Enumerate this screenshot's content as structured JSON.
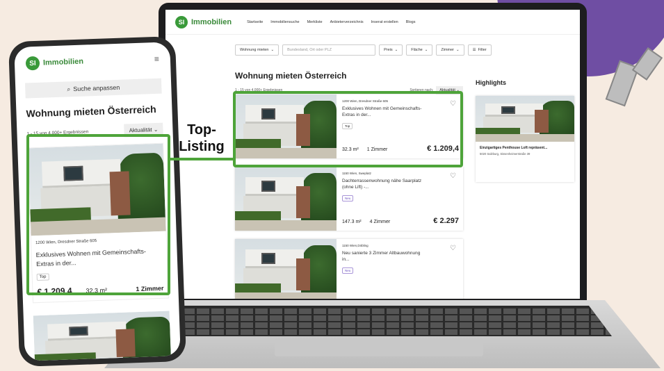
{
  "brand": {
    "name": "Immobilien",
    "mark": "SI",
    "accent": "#3a9a3a",
    "highlight_color": "#4ea43a",
    "deco_color": "#6f4ea3"
  },
  "desktop": {
    "nav": [
      "Startseite",
      "Immobiliensuche",
      "Merkliste",
      "Anbieterverzeichnis",
      "Inserat erstellen",
      "Blogs"
    ],
    "search": {
      "type_label": "Wohnung mieten",
      "placeholder": "Bundesland, Ort oder PLZ",
      "filters": [
        "Preis",
        "Fläche",
        "Zimmer"
      ],
      "more_filters": "Filter"
    },
    "title": "Wohnung mieten Österreich",
    "count": "1 - 15 von 4.000+ Ergebnissen",
    "sort_label": "Sortieren nach:",
    "sort_value": "Aktualität",
    "highlights_title": "Highlights",
    "listings": [
      {
        "address": "1200 Wien, Dresdner Straße 605",
        "title": "Exklusives Wohnen mit Gemeinschafts-Extras in der...",
        "tag": "Top",
        "area": "32.3 m²",
        "rooms": "1 Zimmer",
        "price": "€ 1.209,4"
      },
      {
        "address": "1150 Wien, Sweplatz",
        "title": "Dachterrassenwohnung nähe Saarplatz (ohne Lift) -...",
        "tag": "Neu",
        "area": "147.3 m²",
        "rooms": "4 Zimmer",
        "price": "€ 2.297"
      },
      {
        "address": "1150 Wien,Döbling",
        "title": "Neu sanierte 3 Zimmer Altbauwohnung in...",
        "tag": "Neu",
        "area": "",
        "rooms": "",
        "price": ""
      }
    ],
    "highlight_card": {
      "title": "Einzigartiges Penthouse Loft repräsent...",
      "address": "5020 Salzburg, Sissenheimerstraße 39"
    }
  },
  "mobile": {
    "search_label": "Suche anpassen",
    "title": "Wohnung mieten Österreich",
    "count": "1 - 15 von 4.000+ Ergebnissen",
    "sort_value": "Aktualität",
    "listing": {
      "address": "1200 Wien, Dresdner Straße 605",
      "title": "Exklusives Wohnen mit Gemeinschafts-Extras in der...",
      "tag": "Top",
      "price": "€ 1.209,4",
      "area": "32.3 m²",
      "rooms": "1 Zimmer"
    }
  },
  "callout": {
    "label_line1": "Top-",
    "label_line2": "Listing"
  }
}
